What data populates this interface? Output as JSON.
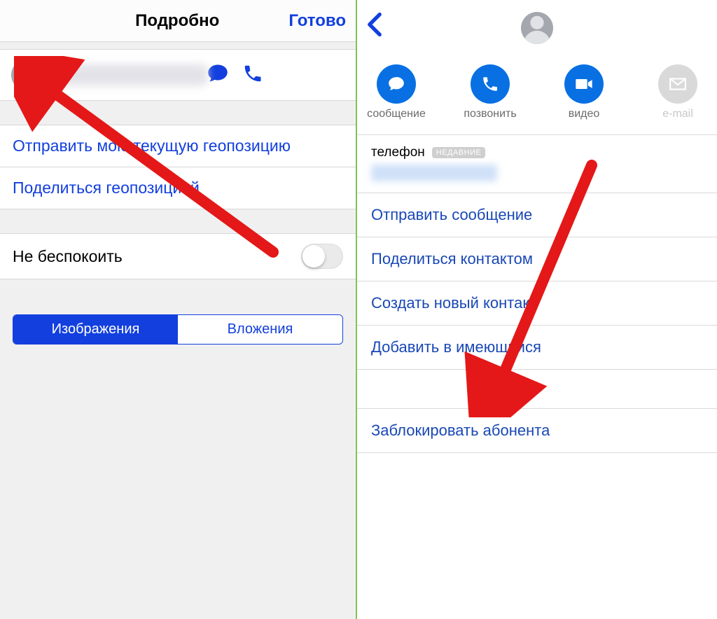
{
  "left": {
    "nav": {
      "title": "Подробно",
      "done": "Готово"
    },
    "share": {
      "send_current_location": "Отправить мою текущую геопозицию",
      "share_location": "Поделиться геопозицией"
    },
    "dnd_label": "Не беспокоить",
    "segmented": {
      "images": "Изображения",
      "attachments": "Вложения"
    }
  },
  "right": {
    "actions": {
      "message": "сообщение",
      "call": "позвонить",
      "video": "видео",
      "email": "e-mail"
    },
    "phone": {
      "label": "телефон",
      "badge": "НЕДАВНИЕ"
    },
    "items": {
      "send_message": "Отправить сообщение",
      "share_contact": "Поделиться контактом",
      "create_contact": "Создать новый контакт",
      "add_to_existing": "Добавить в имеющийся"
    },
    "block": "Заблокировать абонента"
  }
}
